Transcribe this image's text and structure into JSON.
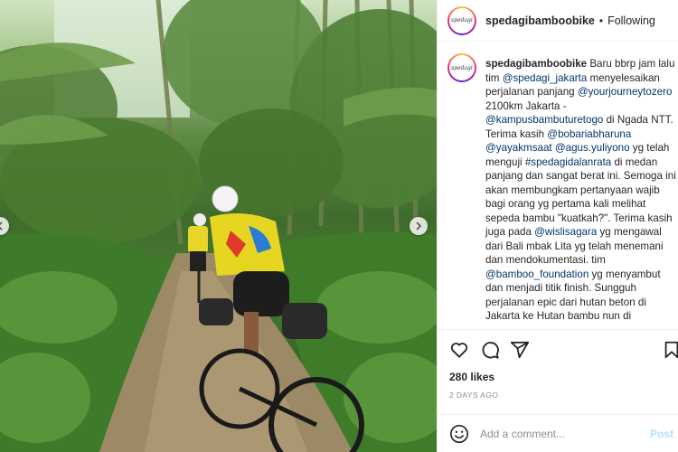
{
  "account": {
    "username": "spedagibamboobike",
    "follow_label": "Following",
    "avatar_text": "spedagi"
  },
  "caption": {
    "username": "spedagibamboobike",
    "t1": " Baru bbrp jam lalu tim ",
    "m1": "@spedagi_jakarta",
    "t2": " menyelesaikan perjalanan panjang ",
    "m2": "@yourjourneytozero",
    "t3": " 2100km Jakarta - ",
    "m3": "@kampusbambuturetogo",
    "t4": " di Ngada NTT. Terima kasih ",
    "m4": "@bobariabharuna",
    "t5": " ",
    "m5": "@yayakmsaat",
    "t6": " ",
    "m6": "@agus.yuliyono",
    "t7": " yg telah menguji ",
    "h1": "#spedagidalanrata",
    "t8": " di medan panjang dan sangat berat ini. Semoga ini akan membungkam pertanyaan wajib bagi orang yg pertama kali melihat sepeda bambu \"kuatkah?\". Terima kasih juga pada ",
    "m7": "@wislisagara",
    "t9": " yg mengawal dari Bali mbak Lita yg telah menemani dan mendokumentasi. tim ",
    "m8": "@bamboo_foundation",
    "t10": " yg menyambut dan menjadi titik finish. Sungguh perjalanan epic dari hutan beton di Jakarta ke Hutan bambu nun di"
  },
  "actions": {
    "like_icon": "heart-icon",
    "comment_icon": "comment-icon",
    "share_icon": "share-icon",
    "save_icon": "bookmark-icon"
  },
  "stats": {
    "likes": "280 likes",
    "date": "2 DAYS AGO"
  },
  "comment": {
    "placeholder": "Add a comment...",
    "post_label": "Post"
  },
  "colors": {
    "link": "#00376b",
    "post_disabled": "#b2dffc",
    "text": "#262626",
    "muted": "#8e8e8e"
  }
}
